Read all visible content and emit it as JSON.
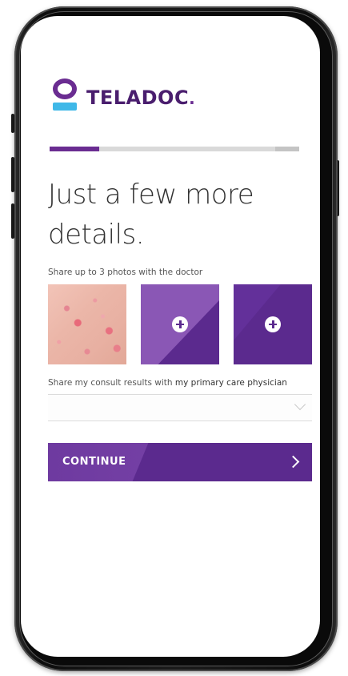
{
  "brand": {
    "name": "TELADOC",
    "mark": ".",
    "colors": {
      "primary": "#5b2a8e",
      "accent": "#3fb8e8"
    }
  },
  "progress": {
    "fraction": 0.2
  },
  "heading": "Just a few more details.",
  "photos": {
    "label": "Share up to 3 photos with the doctor",
    "tiles": [
      {
        "kind": "uploaded-photo"
      },
      {
        "kind": "add",
        "icon": "plus-circle-icon"
      },
      {
        "kind": "add",
        "icon": "plus-circle-icon"
      }
    ]
  },
  "share": {
    "label_prefix": "Share my consult results with ",
    "label_emphasis": "my primary care physician",
    "select_value": "",
    "select_icon": "chevron-down-icon"
  },
  "continue_button": {
    "label": "CONTINUE",
    "icon": "chevron-right-icon"
  }
}
